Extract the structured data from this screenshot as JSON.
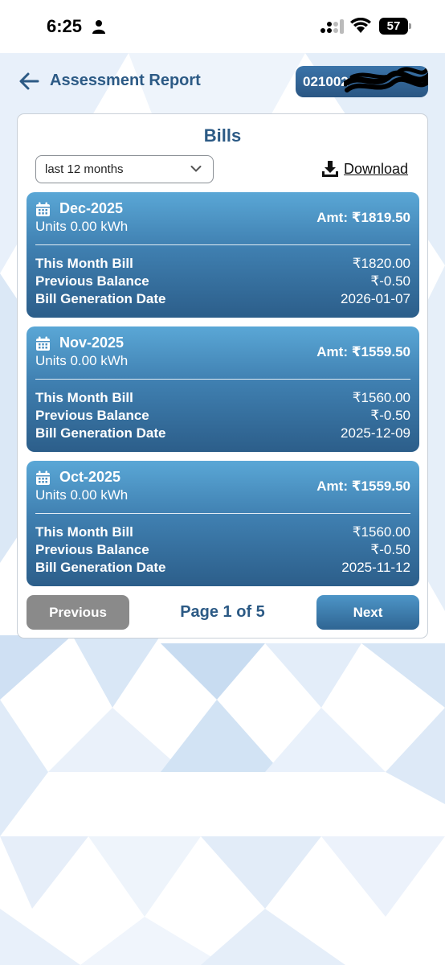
{
  "status_bar": {
    "time": "6:25",
    "battery": "57"
  },
  "header": {
    "title": "Assessment Report",
    "account_number": "021002"
  },
  "bills_section": {
    "title": "Bills",
    "period_filter": {
      "selected": "last 12 months"
    },
    "download_label": "Download"
  },
  "bills": [
    {
      "month": "Dec-2025",
      "units": "Units 0.00 kWh",
      "amount": "Amt: ₹1819.50",
      "this_month_label": "This Month Bill",
      "this_month_value": "₹1820.00",
      "previous_balance_label": "Previous Balance",
      "previous_balance_value": "₹-0.50",
      "generation_date_label": "Bill Generation Date",
      "generation_date_value": "2026-01-07"
    },
    {
      "month": "Nov-2025",
      "units": "Units 0.00 kWh",
      "amount": "Amt: ₹1559.50",
      "this_month_label": "This Month Bill",
      "this_month_value": "₹1560.00",
      "previous_balance_label": "Previous Balance",
      "previous_balance_value": "₹-0.50",
      "generation_date_label": "Bill Generation Date",
      "generation_date_value": "2025-12-09"
    },
    {
      "month": "Oct-2025",
      "units": "Units 0.00 kWh",
      "amount": "Amt: ₹1559.50",
      "this_month_label": "This Month Bill",
      "this_month_value": "₹1560.00",
      "previous_balance_label": "Previous Balance",
      "previous_balance_value": "₹-0.50",
      "generation_date_label": "Bill Generation Date",
      "generation_date_value": "2025-11-12"
    }
  ],
  "pagination": {
    "previous_label": "Previous",
    "page_text": "Page 1 of 5",
    "next_label": "Next"
  },
  "icons": {
    "person": "person-icon",
    "signal": "signal-icon",
    "wifi": "wifi-icon",
    "back": "back-arrow-icon",
    "chevron": "chevron-down-icon",
    "download": "download-icon",
    "calendar": "calendar-icon"
  },
  "colors": {
    "accent": "#2c5a85",
    "card_gradient_top": "#5aa7d6",
    "card_gradient_bottom": "#2c5e8a",
    "previous_button": "#8a8a8a"
  }
}
